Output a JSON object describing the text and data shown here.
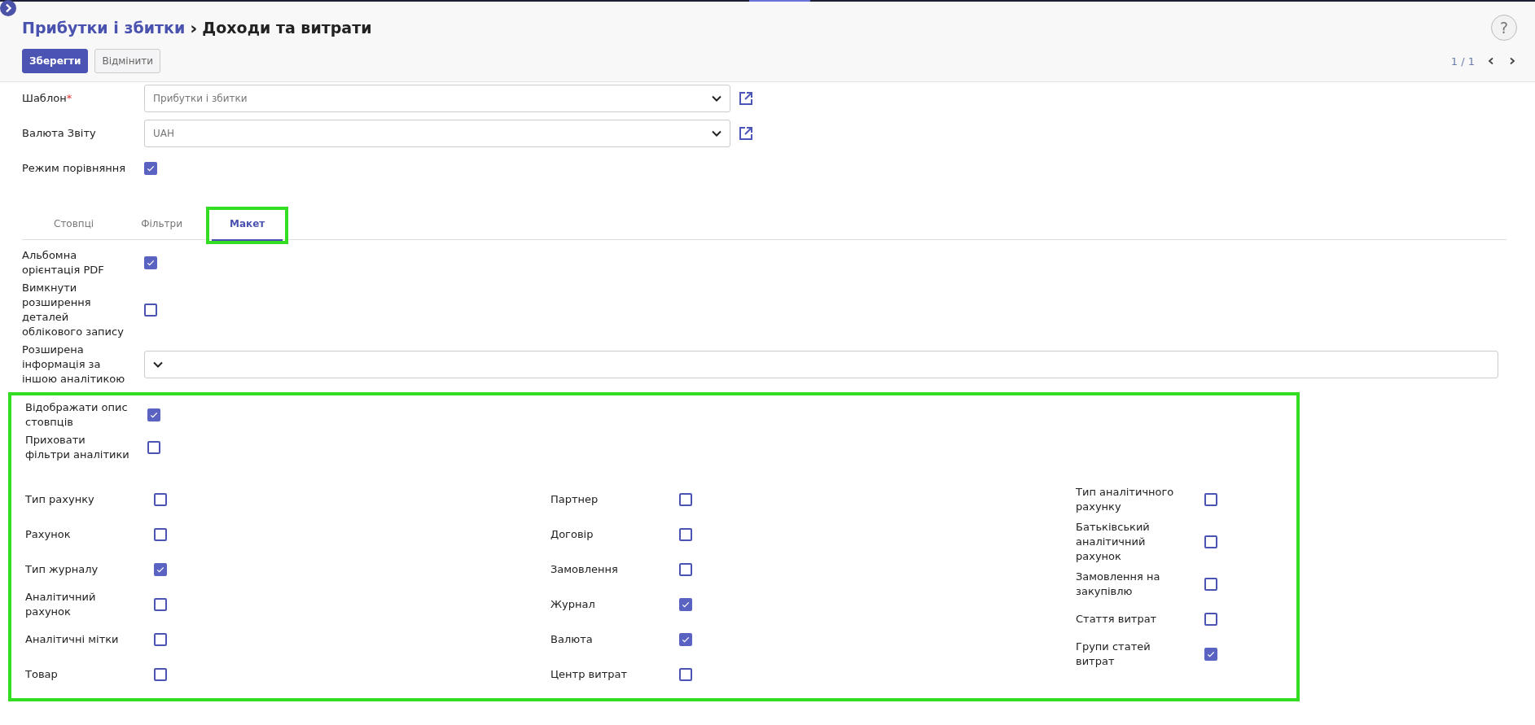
{
  "breadcrumb": {
    "parent": "Прибутки і збитки",
    "separator": "›",
    "current": "Доходи та витрати"
  },
  "buttons": [
    {
      "label": "Зберегти",
      "kind": "primary"
    },
    {
      "label": "Відмінити",
      "kind": "secondary"
    }
  ],
  "help": "?",
  "pager": "1 / 1",
  "fields": [
    {
      "kind": "select",
      "label": "Шаблон",
      "required_mark": "*",
      "value": "Прибутки і збитки"
    },
    {
      "kind": "select",
      "label": "Валюта Звіту",
      "value": "UAH"
    },
    {
      "kind": "checkbox",
      "label": "Режим порівняння",
      "checked": true
    }
  ],
  "tabs": [
    {
      "label": "Стовпці",
      "selected": false,
      "highlighted": false
    },
    {
      "label": "Фільтри",
      "selected": false,
      "highlighted": false
    },
    {
      "label": "Макет",
      "selected": true,
      "highlighted": true
    }
  ],
  "layout_options": [
    {
      "kind": "checkbox",
      "label": "Альбомна орієнтація PDF",
      "checked": true
    },
    {
      "kind": "checkbox",
      "label": "Вимкнути розширення деталей облікового запису",
      "checked": false
    },
    {
      "kind": "select",
      "label": "Розширена інформація за іншою аналітикою"
    }
  ],
  "highlighted_section": {
    "highlighted": true,
    "options": [
      {
        "label": "Відображати опис стовпців",
        "checked": true
      },
      {
        "label": "Приховати фільтри аналітики",
        "checked": false
      }
    ],
    "columns": [
      [
        {
          "label": "Тип рахунку",
          "checked": false
        },
        {
          "label": "Рахунок",
          "checked": false
        },
        {
          "label": "Тип журналу",
          "checked": true
        },
        {
          "label": "Аналітичний рахунок",
          "checked": false
        },
        {
          "label": "Аналітичні мітки",
          "checked": false
        },
        {
          "label": "Товар",
          "checked": false
        }
      ],
      [
        {
          "label": "Партнер",
          "checked": false
        },
        {
          "label": "Договір",
          "checked": false
        },
        {
          "label": "Замовлення",
          "checked": false
        },
        {
          "label": "Журнал",
          "checked": true
        },
        {
          "label": "Валюта",
          "checked": true
        },
        {
          "label": "Центр витрат",
          "checked": false
        }
      ],
      [
        {
          "label": "Тип аналітичного рахунку",
          "checked": false
        },
        {
          "label": "Батьківський аналітичний рахунок",
          "checked": false
        },
        {
          "label": "Замовлення на закупівлю",
          "checked": false
        },
        {
          "label": "Стаття витрат",
          "checked": false
        },
        {
          "label": "Групи статей витрат",
          "checked": true
        }
      ]
    ]
  }
}
